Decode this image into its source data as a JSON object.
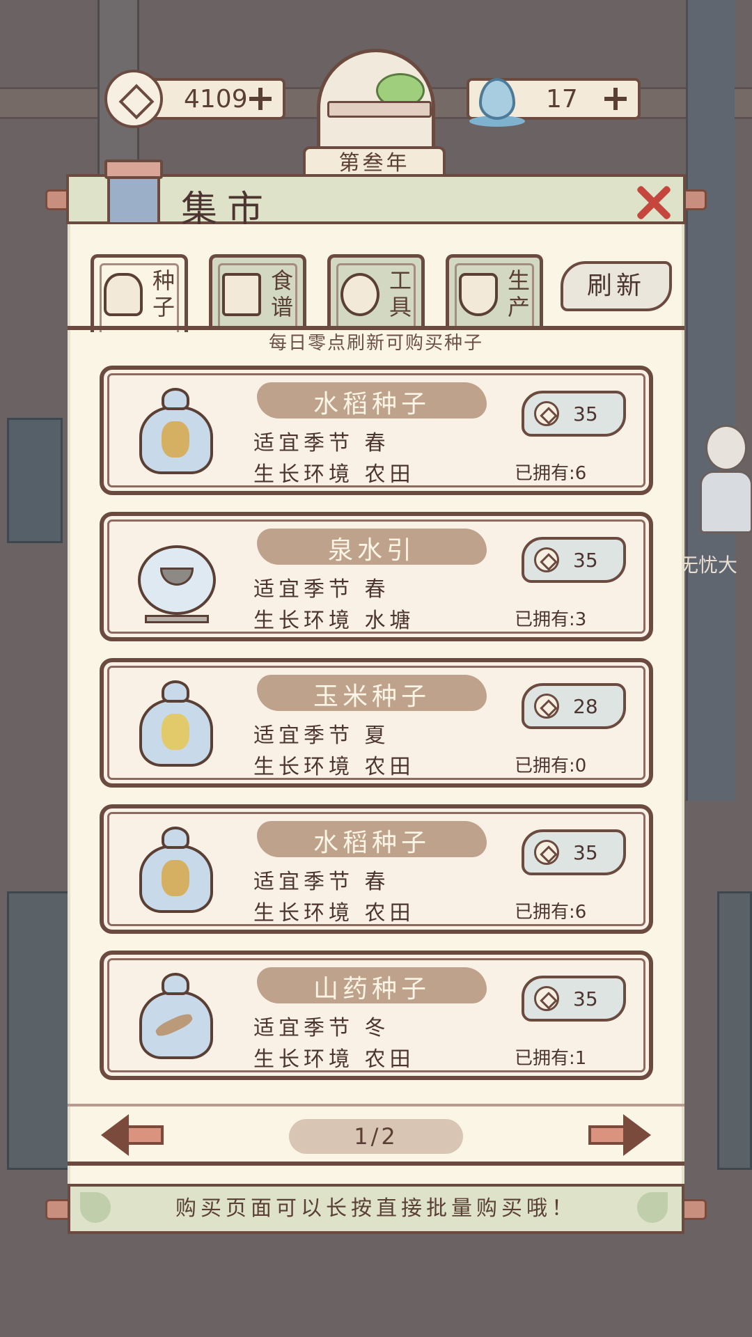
{
  "hud": {
    "coins": "4109",
    "water": "17",
    "year": "第叁年"
  },
  "panel": {
    "title": "集市",
    "notice": "每日零点刷新可购买种子",
    "refresh_label": "刷新"
  },
  "tabs": [
    {
      "line1": "种",
      "line2": "子",
      "active": true
    },
    {
      "line1": "食",
      "line2": "谱",
      "active": false
    },
    {
      "line1": "工",
      "line2": "具",
      "active": false
    },
    {
      "line1": "生",
      "line2": "产",
      "active": false
    }
  ],
  "items": [
    {
      "name": "水稻种子",
      "season": "适宜季节 春",
      "env": "生长环境 农田",
      "price": "35",
      "owned": "已拥有:6",
      "icon": "rice-seed-bag-icon"
    },
    {
      "name": "泉水引",
      "season": "适宜季节 春",
      "env": "生长环境 水塘",
      "price": "35",
      "owned": "已拥有:3",
      "icon": "spring-water-bowl-icon"
    },
    {
      "name": "玉米种子",
      "season": "适宜季节 夏",
      "env": "生长环境 农田",
      "price": "28",
      "owned": "已拥有:0",
      "icon": "corn-seed-bag-icon"
    },
    {
      "name": "水稻种子",
      "season": "适宜季节 春",
      "env": "生长环境 农田",
      "price": "35",
      "owned": "已拥有:6",
      "icon": "rice-seed-bag-icon"
    },
    {
      "name": "山药种子",
      "season": "适宜季节 冬",
      "env": "生长环境 农田",
      "price": "35",
      "owned": "已拥有:1",
      "icon": "yam-seed-bag-icon"
    }
  ],
  "pagination": {
    "current": "1/2"
  },
  "tip": "购买页面可以长按直接批量购买哦！",
  "npc_name": "无忧大",
  "colors": {
    "background": "#6b6263",
    "panel": "#fbf5e6",
    "border": "#6b4a40",
    "close": "#c4463d",
    "header": "#dde2c9"
  }
}
